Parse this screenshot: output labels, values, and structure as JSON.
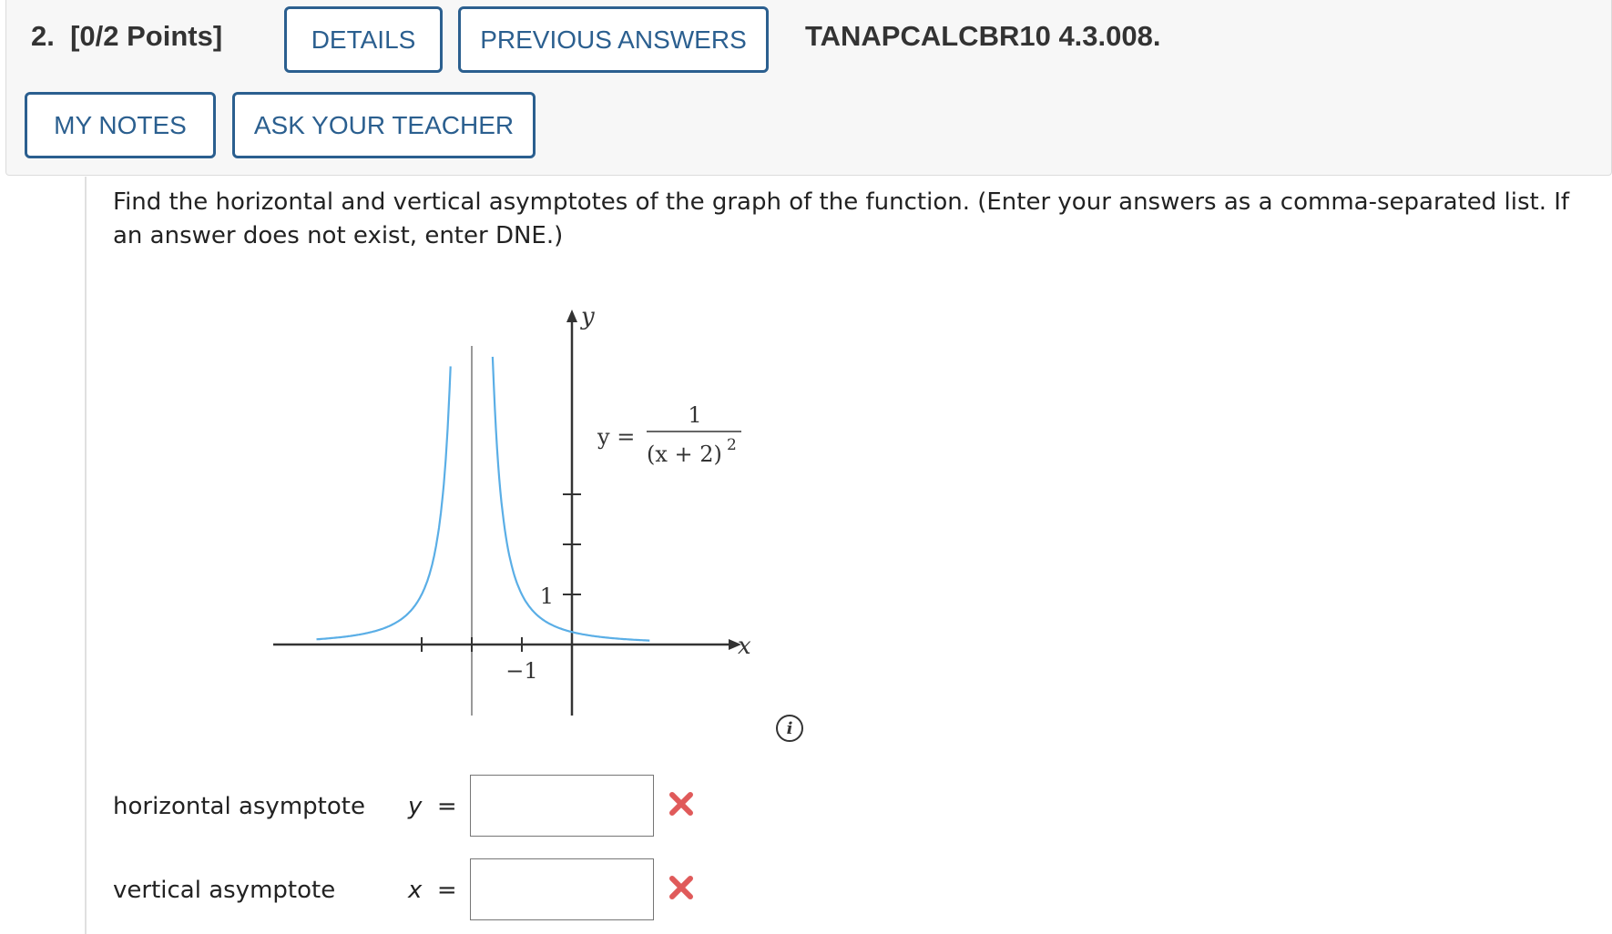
{
  "header": {
    "question_number": "2.",
    "points": "[0/2 Points]",
    "details_label": "DETAILS",
    "previous_answers_label": "PREVIOUS ANSWERS",
    "problem_code": "TANAPCALCBR10 4.3.008.",
    "my_notes_label": "MY NOTES",
    "ask_teacher_label": "ASK YOUR TEACHER"
  },
  "prompt": "Find the horizontal and vertical asymptotes of the graph of the function. (Enter your answers as a comma-separated list. If an answer does not exist, enter DNE.)",
  "graph": {
    "y_axis_label": "y",
    "x_axis_label": "x",
    "tick_label_y": "1",
    "tick_label_x": "−1",
    "equation_lhs": "y =",
    "equation_numerator": "1",
    "equation_denominator": "(x + 2)",
    "equation_exponent": "2",
    "curve_color": "#5aaee6",
    "asymptote_color": "#999999"
  },
  "info_icon": "i",
  "answers": {
    "horizontal": {
      "label": "horizontal asymptote",
      "variable": "y",
      "equals": "=",
      "value": "",
      "status": "incorrect"
    },
    "vertical": {
      "label": "vertical asymptote",
      "variable": "x",
      "equals": "=",
      "value": "",
      "status": "incorrect"
    }
  },
  "colors": {
    "button_border": "#2b5f8f",
    "incorrect_mark": "#e05a5a"
  }
}
